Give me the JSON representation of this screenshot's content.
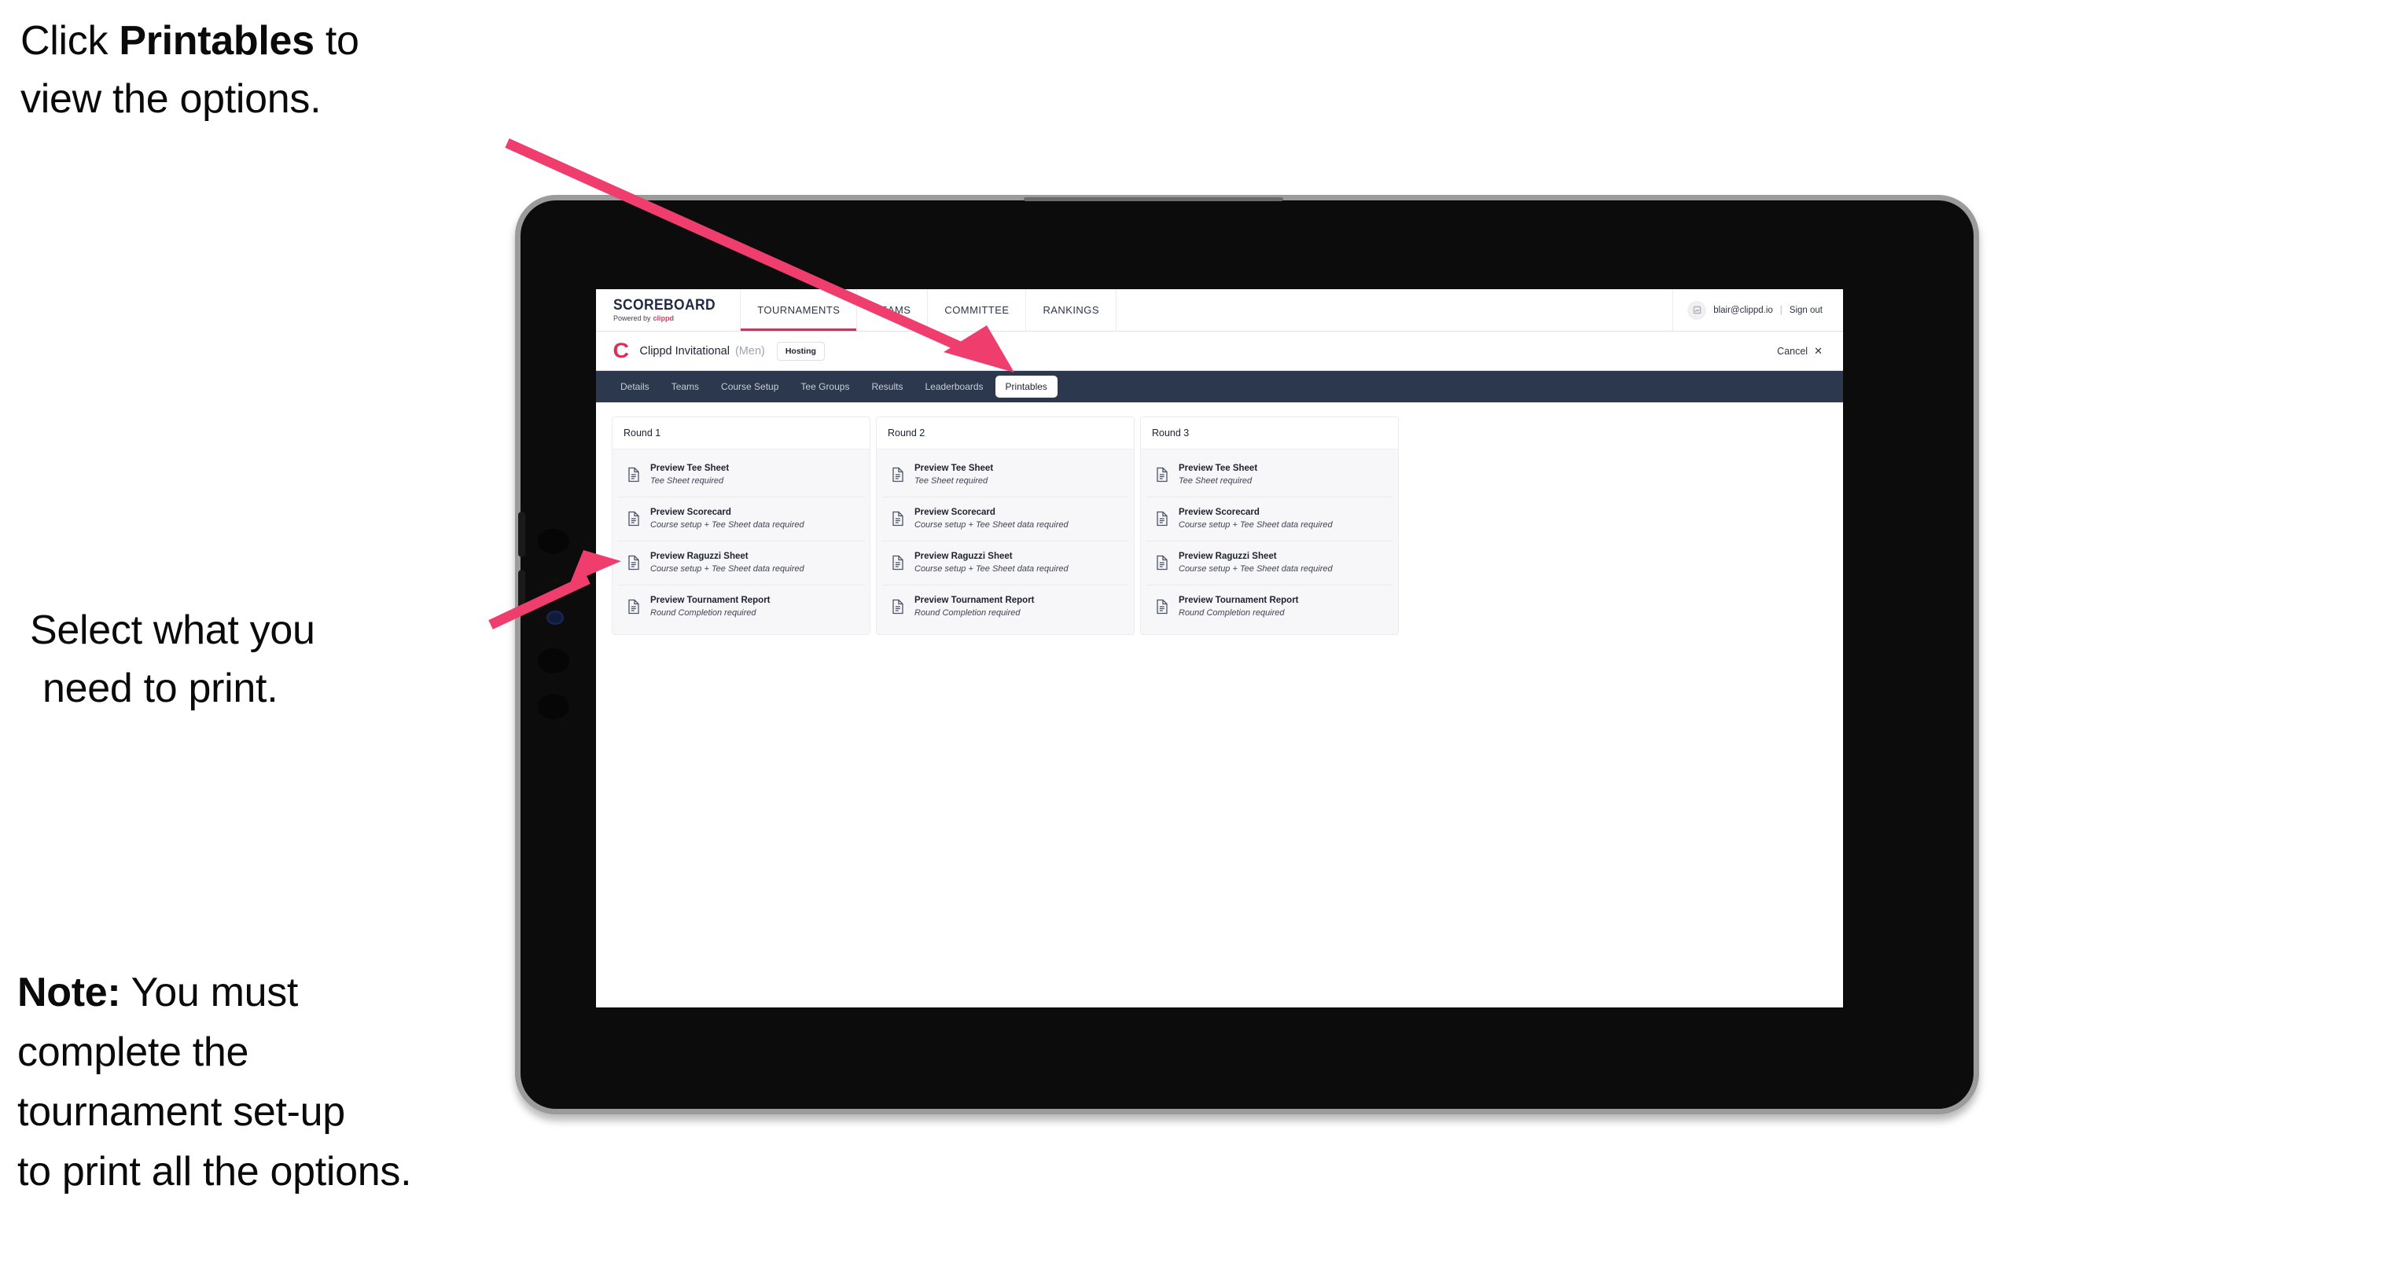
{
  "annotations": {
    "first": {
      "lead": "Click ",
      "bold": "Printables",
      "tail": " to",
      "line2": "view the options."
    },
    "second": {
      "line1": "Select what you",
      "line2": "need to print."
    },
    "note": {
      "bold": "Note:",
      "rest": " You must",
      "line2": "complete the",
      "line3": "tournament set-up",
      "line4": "to print all the options."
    }
  },
  "colors": {
    "arrow": "#ef3e6d",
    "tabbar": "#2c384e",
    "brand_accent": "#e03a5f",
    "clippd_red": "#dd2f55",
    "active_underline": "#b8405e"
  },
  "app": {
    "brand": {
      "title": "SCOREBOARD",
      "powered_by": "Powered by",
      "clippd": "clippd"
    },
    "topnav": [
      {
        "label": "TOURNAMENTS",
        "active": true
      },
      {
        "label": "TEAMS",
        "active": false
      },
      {
        "label": "COMMITTEE",
        "active": false
      },
      {
        "label": "RANKINGS",
        "active": false
      }
    ],
    "account": {
      "avatar_icon": "user-avatar-icon",
      "email": "blair@clippd.io",
      "separator": "|",
      "sign_out": "Sign out"
    },
    "titlebar": {
      "logo_letter": "C",
      "tournament_name": "Clippd Invitational",
      "gender": "(Men)",
      "badge": "Hosting",
      "cancel_label": "Cancel",
      "cancel_icon": "close-icon"
    },
    "tabs": [
      {
        "label": "Details",
        "active": false
      },
      {
        "label": "Teams",
        "active": false
      },
      {
        "label": "Course Setup",
        "active": false
      },
      {
        "label": "Tee Groups",
        "active": false
      },
      {
        "label": "Results",
        "active": false
      },
      {
        "label": "Leaderboards",
        "active": false
      },
      {
        "label": "Printables",
        "active": true
      }
    ],
    "rounds": [
      {
        "title": "Round 1",
        "items": [
          {
            "title": "Preview Tee Sheet",
            "subtitle": "Tee Sheet required",
            "icon": "document-icon"
          },
          {
            "title": "Preview Scorecard",
            "subtitle": "Course setup + Tee Sheet data required",
            "icon": "document-icon"
          },
          {
            "title": "Preview Raguzzi Sheet",
            "subtitle": "Course setup + Tee Sheet data required",
            "icon": "document-icon"
          },
          {
            "title": "Preview Tournament Report",
            "subtitle": "Round Completion required",
            "icon": "document-icon"
          }
        ]
      },
      {
        "title": "Round 2",
        "items": [
          {
            "title": "Preview Tee Sheet",
            "subtitle": "Tee Sheet required",
            "icon": "document-icon"
          },
          {
            "title": "Preview Scorecard",
            "subtitle": "Course setup + Tee Sheet data required",
            "icon": "document-icon"
          },
          {
            "title": "Preview Raguzzi Sheet",
            "subtitle": "Course setup + Tee Sheet data required",
            "icon": "document-icon"
          },
          {
            "title": "Preview Tournament Report",
            "subtitle": "Round Completion required",
            "icon": "document-icon"
          }
        ]
      },
      {
        "title": "Round 3",
        "items": [
          {
            "title": "Preview Tee Sheet",
            "subtitle": "Tee Sheet required",
            "icon": "document-icon"
          },
          {
            "title": "Preview Scorecard",
            "subtitle": "Course setup + Tee Sheet data required",
            "icon": "document-icon"
          },
          {
            "title": "Preview Raguzzi Sheet",
            "subtitle": "Course setup + Tee Sheet data required",
            "icon": "document-icon"
          },
          {
            "title": "Preview Tournament Report",
            "subtitle": "Round Completion required",
            "icon": "document-icon"
          }
        ]
      }
    ]
  }
}
